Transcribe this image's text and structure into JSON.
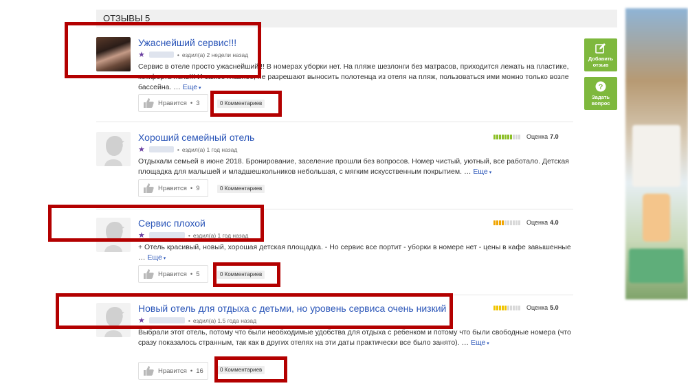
{
  "header": {
    "title": "ОТЗЫВЫ 5"
  },
  "reviews": [
    {
      "title": "Ужаснейший сервис!!!",
      "travel": "ездил(а) 2 недели назад",
      "text": "Сервис в отеле просто ужаснейший!!! В номерах уборки нет. На пляже шезлонги без матрасов, приходится лежать на пластике, комфорта ноль!!! И самое главное, не разрешают выносить полотенца из отеля на пляж, пользоваться ими можно только возле бассейна. …",
      "more": "Еще",
      "like_label": "Нравится",
      "like_count": "3",
      "comments": "0 Комментариев",
      "rating": null
    },
    {
      "title": "Хороший семейный отель",
      "travel": "ездил(а) 1 год назад",
      "text": "Отдыхали семьей в июне 2018. Бронирование, заселение прошли без вопросов. Номер чистый, уютный, все работало. Детская площадка для малышей и младшешкольников небольшая, с мягким искусственным покрытием. …",
      "more": "Еще",
      "like_label": "Нравится",
      "like_count": "9",
      "comments": "0 Комментариев",
      "rating": {
        "label": "Оценка",
        "value": "7.0",
        "score": 7.0,
        "color": "#8cbf26"
      }
    },
    {
      "title": "Сервис плохой",
      "travel": "ездил(а) 1 год назад",
      "text": "+ Отель красивый, новый, хорошая детская площадка. - Но сервис все портит - уборки в номере нет - цены в кафе завышенные …",
      "more": "Еще",
      "like_label": "Нравится",
      "like_count": "5",
      "comments": "0 Комментариев",
      "rating": {
        "label": "Оценка",
        "value": "4.0",
        "score": 4.0,
        "color": "#f0a400"
      }
    },
    {
      "title": "Новый отель для отдыха с детьми, но уровень сервиса очень низкий",
      "travel": "ездил(а) 1.5 года назад",
      "text": "Выбрали этот отель, потому что были необходимые удобства для отдыха с ребенком и потому что были свободные номера (что сразу показалось странным, так как в других отелях на эти даты практически все было занято). …",
      "more": "Еще",
      "like_label": "Нравится",
      "like_count": "16",
      "comments": "0 Комментариев",
      "rating": {
        "label": "Оценка",
        "value": "5.0",
        "score": 5.0,
        "color": "#f0c400"
      }
    }
  ],
  "side": {
    "add_review": "Добавить отзыв",
    "ask_question": "Задать вопрос"
  },
  "colors": {
    "link": "#2a55b8",
    "annotation": "#b30000",
    "side_button": "#7eb83d",
    "star": "#6a3fa0"
  }
}
